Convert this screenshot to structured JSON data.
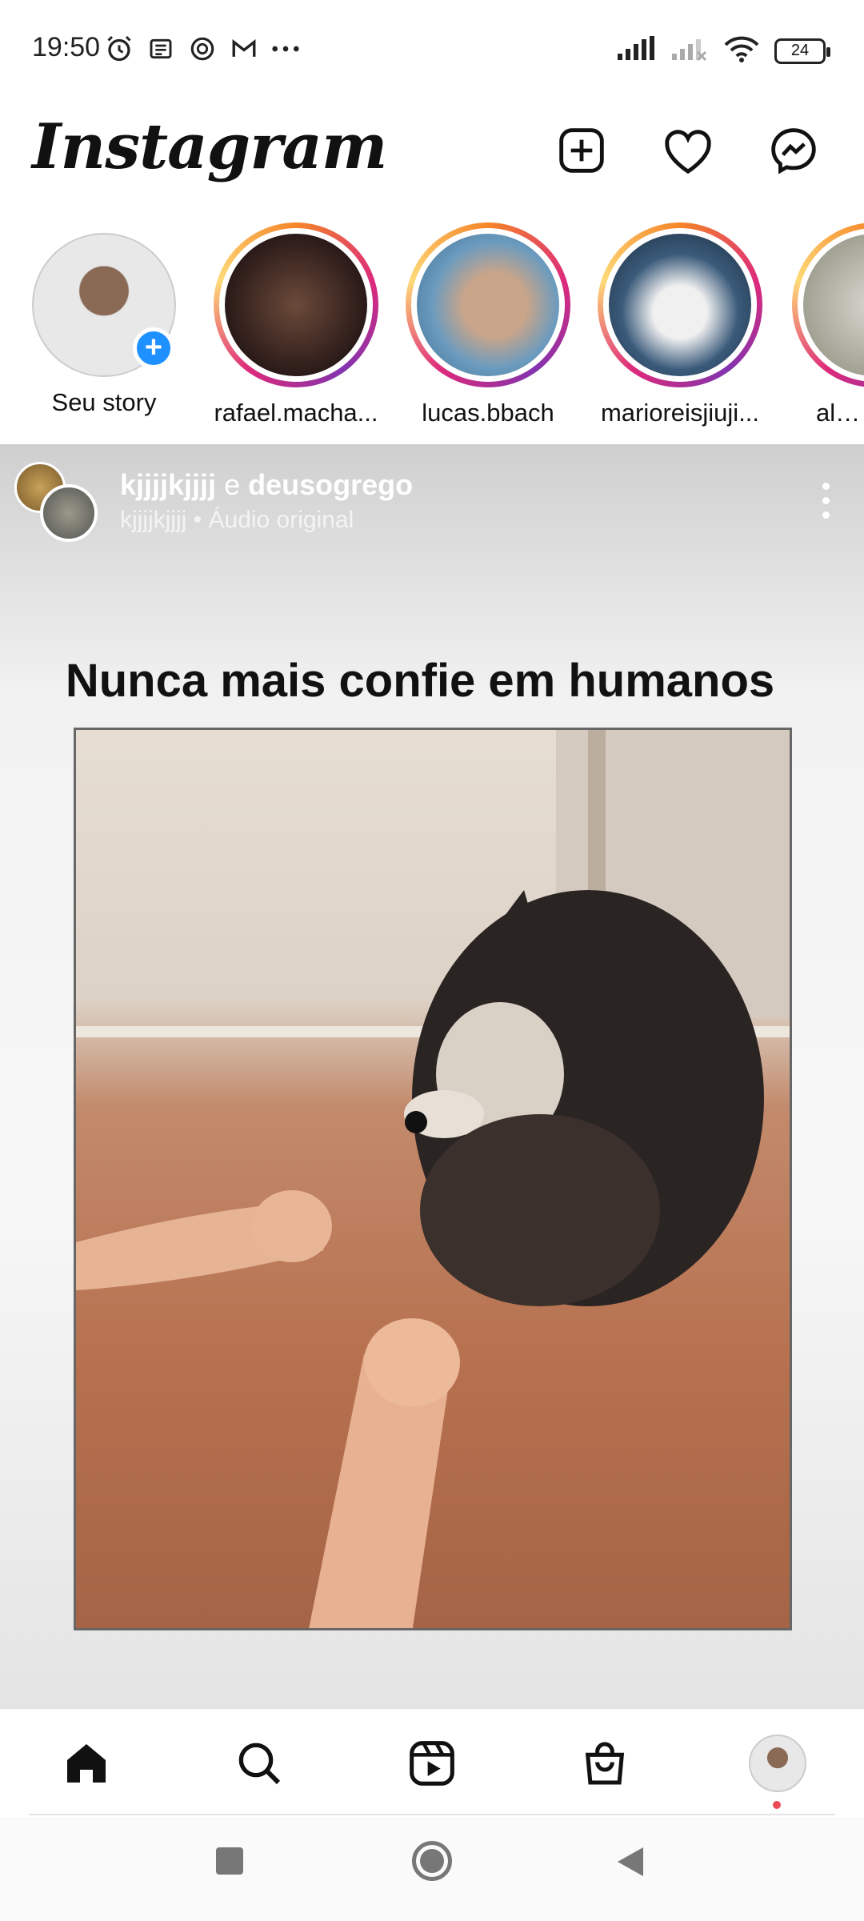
{
  "status_bar": {
    "time": "19:50",
    "battery": "24",
    "left_icons": [
      "alarm-icon",
      "news-icon",
      "threads-icon",
      "gmail-icon",
      "more-dots-icon"
    ],
    "right_icons": [
      "signal-icon",
      "signal-weak-icon",
      "wifi-icon",
      "battery-icon"
    ]
  },
  "header": {
    "logo": "Instagram",
    "icons": [
      "add-post-icon",
      "heart-icon",
      "messenger-icon"
    ]
  },
  "stories": [
    {
      "label": "Seu story",
      "own": true
    },
    {
      "label": "rafael.macha..."
    },
    {
      "label": "lucas.bbach"
    },
    {
      "label": "marioreisjiuji..."
    },
    {
      "label": "alem"
    }
  ],
  "post": {
    "user1": "kjjjjkjjjj",
    "connector": "e",
    "user2": "deusogrego",
    "subtitle": "kjjjjkjjjj • Áudio original",
    "caption": "Nunca mais confie em humanos"
  },
  "bottom_nav": [
    "home-icon",
    "search-icon",
    "reels-icon",
    "shop-icon",
    "profile-avatar"
  ],
  "colors": {
    "story_ring": "#dd2a7b",
    "add_story": "#1e90ff",
    "notification_dot": "#ed4956"
  }
}
